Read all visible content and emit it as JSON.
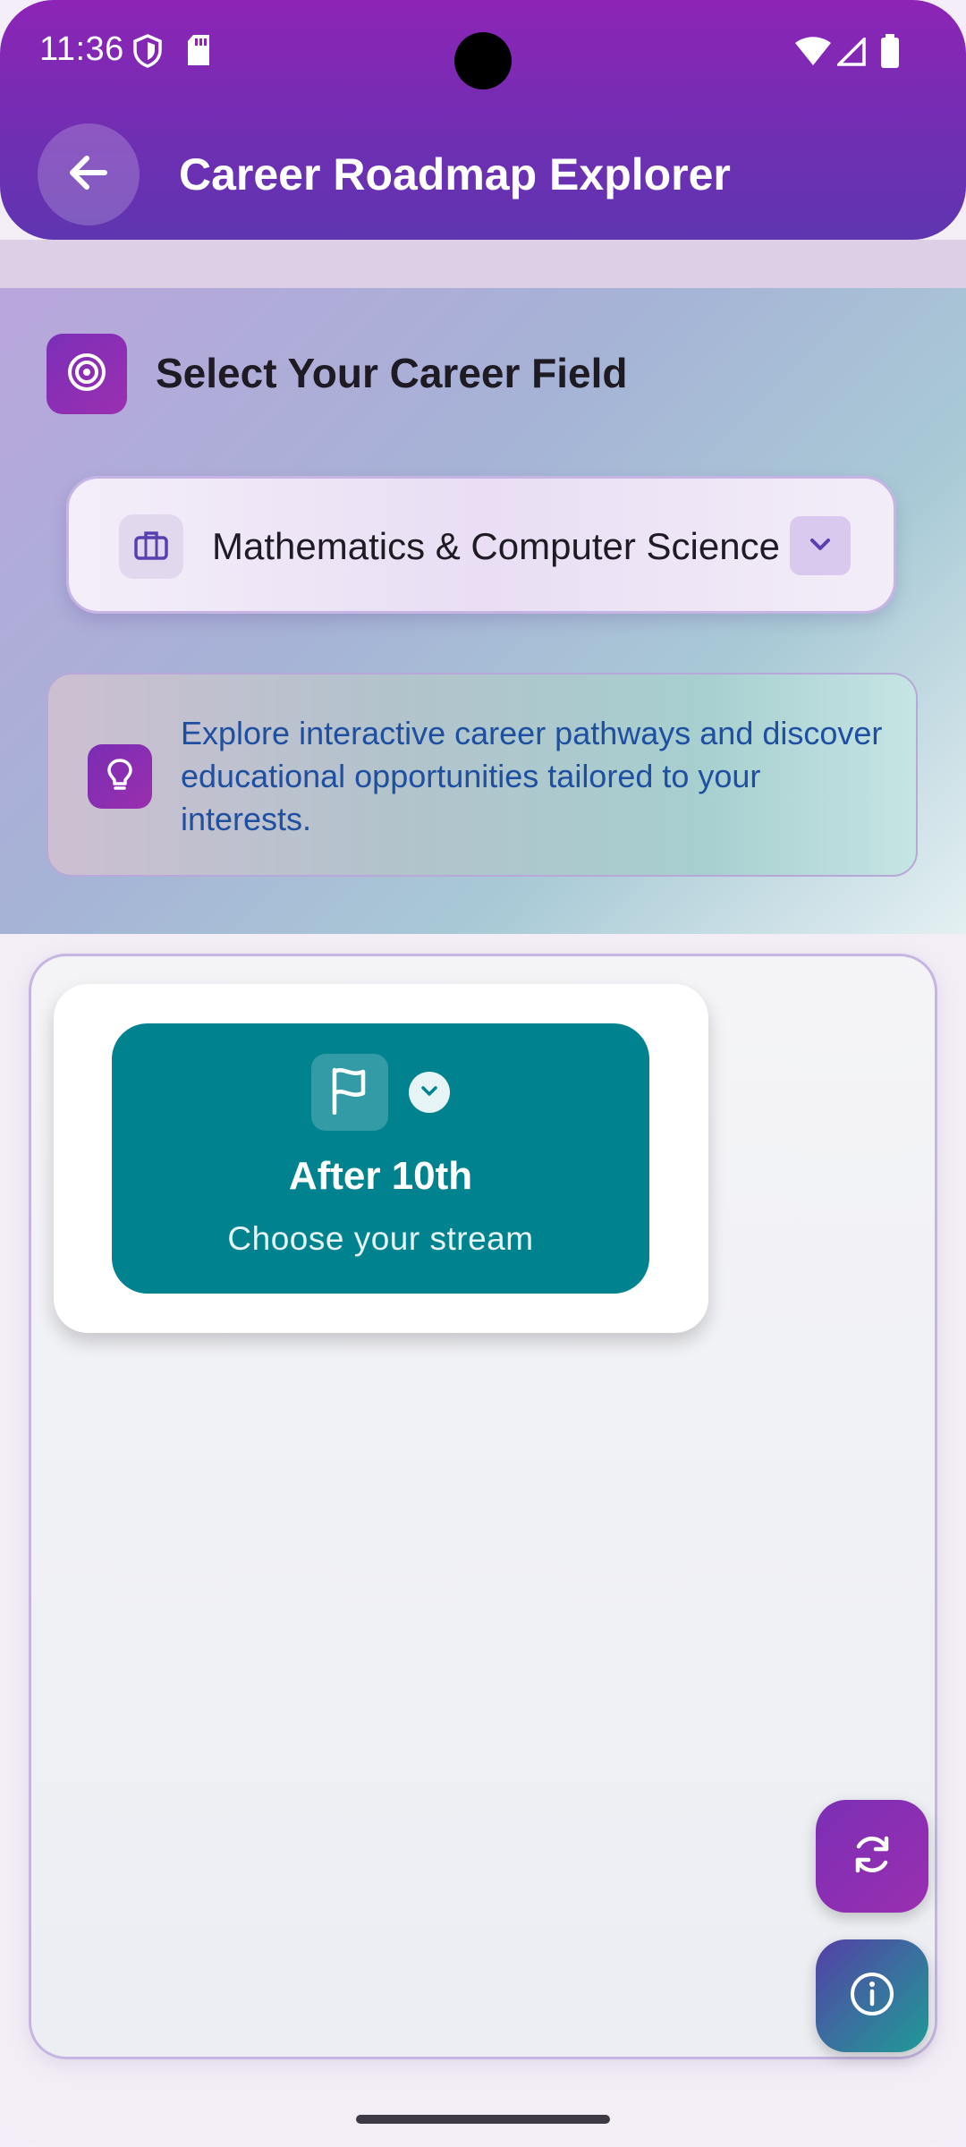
{
  "status_bar": {
    "time": "11:36"
  },
  "app_bar": {
    "title": "Career Roadmap Explorer"
  },
  "selector": {
    "heading": "Select Your Career Field",
    "selected_field": "Mathematics & Computer Science"
  },
  "info_banner": {
    "text": "Explore interactive career pathways and discover educational opportunities tailored to your interests."
  },
  "roadmap": {
    "nodes": [
      {
        "title": "After 10th",
        "subtitle": "Choose your stream"
      }
    ]
  },
  "colors": {
    "primary": "#8d24b6",
    "node": "#00838f",
    "info_text": "#1e4fa0"
  },
  "icons": {
    "back": "arrow-left-icon",
    "section": "target-icon",
    "dropdown_leading": "briefcase-icon",
    "dropdown_trailing": "chevron-down-icon",
    "info": "lightbulb-icon",
    "node": "flag-icon",
    "refresh_fab": "refresh-icon",
    "info_fab": "info-icon"
  }
}
